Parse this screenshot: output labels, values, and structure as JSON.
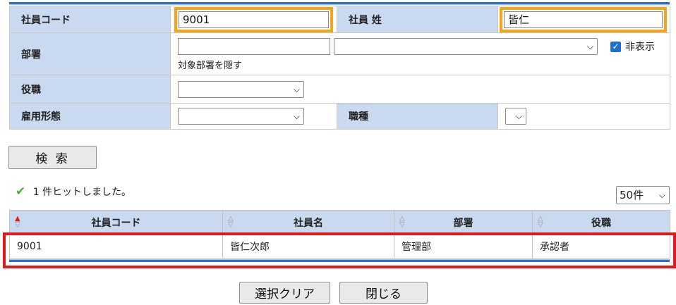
{
  "search_form": {
    "employee_code_label": "社員コード",
    "employee_code_value": "9001",
    "surname_label": "社員 姓",
    "surname_value": "皆仁",
    "department_label": "部署",
    "department_code_value": "",
    "department_select_value": "",
    "hide_checkbox_label": "非表示",
    "hide_checkbox_checked": true,
    "department_note": "対象部署を隠す",
    "position_label": "役職",
    "position_select_value": "",
    "employment_type_label": "雇用形態",
    "employment_type_select_value": "",
    "job_type_label": "職種",
    "job_type_select_value": ""
  },
  "search_button_label": "検 索",
  "result_message": "1 件ヒットしました。",
  "page_size_value": "50件",
  "results_table": {
    "headers": [
      "社員コード",
      "社員名",
      "部署",
      "役職"
    ],
    "rows": [
      [
        "9001",
        "皆仁次郎",
        "管理部",
        "承認者"
      ]
    ]
  },
  "footer": {
    "clear_button_label": "選択クリア",
    "close_button_label": "閉じる"
  },
  "colors": {
    "label_bg": "#c9d9ef",
    "accent_blue": "#2f6fcf",
    "highlight_orange": "#f3a41b",
    "highlight_red": "#e01b1b",
    "success_green": "#4caf2d"
  }
}
